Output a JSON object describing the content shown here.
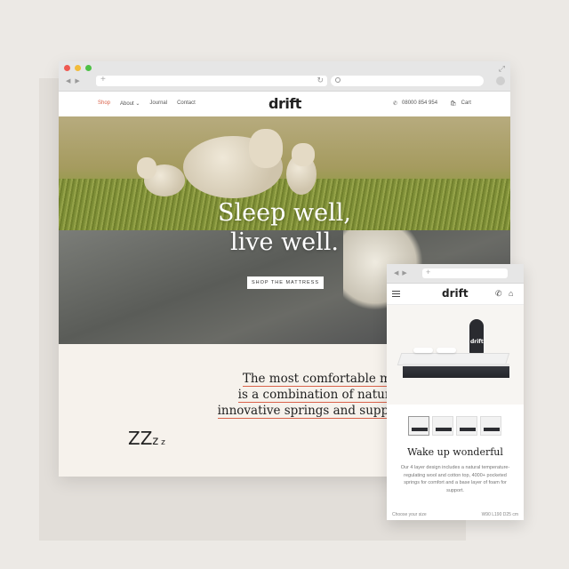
{
  "desktop": {
    "nav": {
      "links": [
        {
          "label": "Shop"
        },
        {
          "label": "About ⌄"
        },
        {
          "label": "Journal"
        },
        {
          "label": "Contact"
        }
      ],
      "logo": "drift",
      "phone": "08000 854 954",
      "cart": "Cart"
    },
    "hero": {
      "title_line1": "Sleep well,",
      "title_line2": "live well.",
      "cta": "SHOP THE MATTRESS"
    },
    "tagline": {
      "line1": "The most comfortable mattress",
      "line2": "is a combination of natural wool,",
      "line3": "innovative springs and supportive foam"
    },
    "zzz": "ZZZ z"
  },
  "mobile": {
    "logo": "drift",
    "product_label": "drift",
    "title": "Wake up wonderful",
    "description": "Our 4 layer design includes a natural temperature-regulating wool and cotton top, 4000+ pocketed springs for comfort and a base layer of foam for support.",
    "footer_left": "Choose your size",
    "footer_right": "W90 L190 D25 cm"
  },
  "colors": {
    "accent": "#d9624a",
    "background": "#ece9e5",
    "content_bg": "#f6f2ec"
  },
  "icons": [
    "back-arrow-icon",
    "forward-arrow-icon",
    "plus-icon",
    "reload-icon",
    "search-icon",
    "expand-icon",
    "phone-icon",
    "cart-icon",
    "menu-icon"
  ]
}
